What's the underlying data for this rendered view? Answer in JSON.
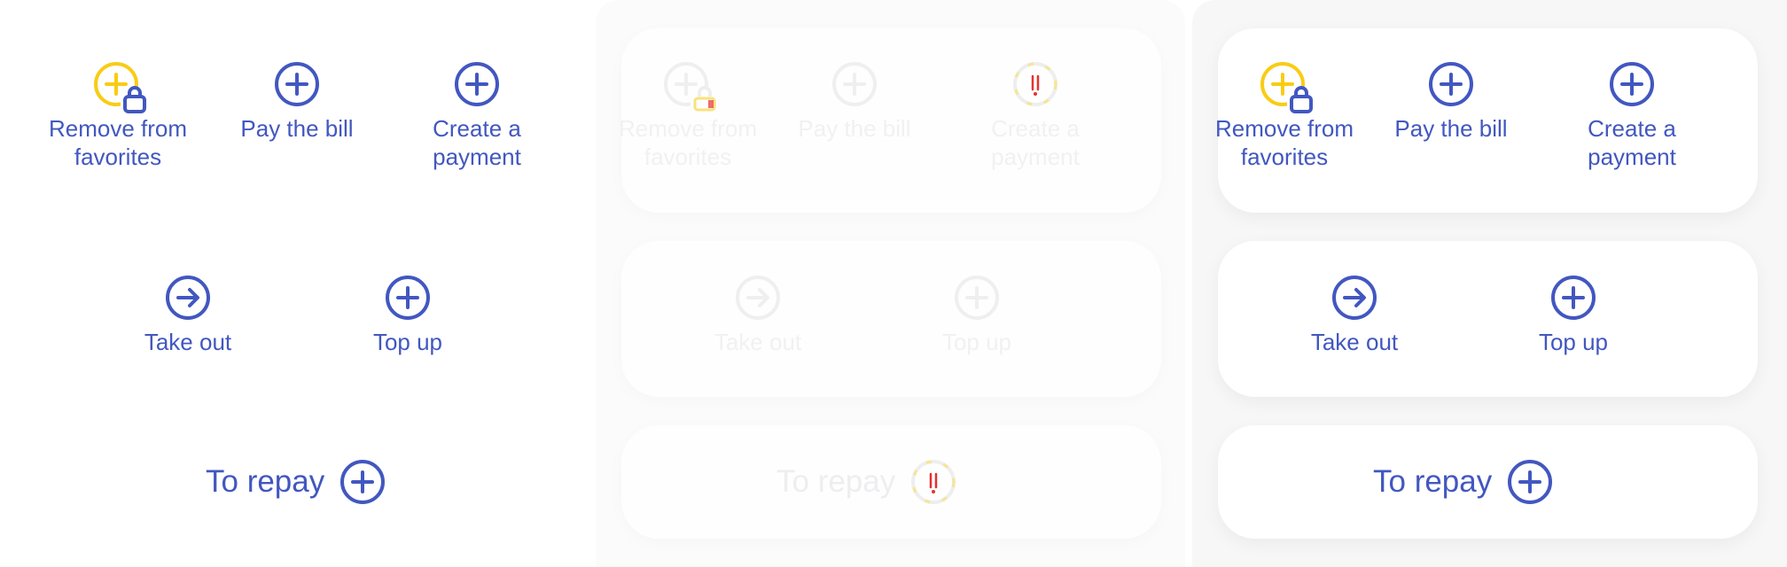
{
  "colors": {
    "primary": "#4257c0",
    "favorite_accent": "#f9cc14",
    "faded_text": "#f1f1f3",
    "faded_icon": "#efefef",
    "error_mark": "#e43131"
  },
  "variants": [
    {
      "state": "plain",
      "row1": [
        {
          "label": "Remove from\nfavorites",
          "icon": "remove-favorite-lock-icon"
        },
        {
          "label": "Pay the bill",
          "icon": "plus-circle-icon"
        },
        {
          "label": "Create a\npayment",
          "icon": "plus-circle-icon"
        }
      ],
      "row2": [
        {
          "label": "Take out",
          "icon": "arrow-right-circle-icon"
        },
        {
          "label": "Top up",
          "icon": "plus-circle-icon"
        }
      ],
      "row3": {
        "label": "To repay",
        "icon": "plus-circle-icon"
      }
    },
    {
      "state": "disabled",
      "row1": [
        {
          "label": "Remove from\nfavorites",
          "icon": "remove-favorite-lock-icon"
        },
        {
          "label": "Pay the bill",
          "icon": "plus-circle-icon"
        },
        {
          "label": "Create a\npayment",
          "icon": "error-circle-icon"
        }
      ],
      "row2": [
        {
          "label": "Take out",
          "icon": "arrow-right-circle-icon"
        },
        {
          "label": "Top up",
          "icon": "plus-circle-icon"
        }
      ],
      "row3": {
        "label": "To repay",
        "icon": "error-circle-icon"
      }
    },
    {
      "state": "card",
      "row1": [
        {
          "label": "Remove from\nfavorites",
          "icon": "remove-favorite-lock-icon"
        },
        {
          "label": "Pay the bill",
          "icon": "plus-circle-icon"
        },
        {
          "label": "Create a\npayment",
          "icon": "plus-circle-icon"
        }
      ],
      "row2": [
        {
          "label": "Take out",
          "icon": "arrow-right-circle-icon"
        },
        {
          "label": "Top up",
          "icon": "plus-circle-icon"
        }
      ],
      "row3": {
        "label": "To repay",
        "icon": "plus-circle-icon"
      }
    }
  ]
}
